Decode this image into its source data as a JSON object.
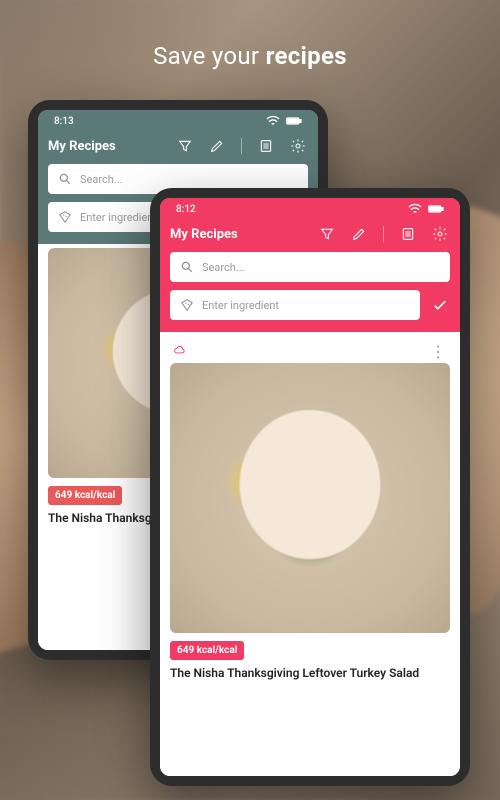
{
  "headline": {
    "prefix": "Save your ",
    "bold": "recipes"
  },
  "back": {
    "time": "8:13",
    "title": "My Recipes",
    "search_placeholder": "Search...",
    "ingredient_placeholder": "Enter ingredient",
    "card": {
      "kcal": "649 kcal/kcal",
      "title": "The Nisha Thanksgiv"
    }
  },
  "front": {
    "time": "8:12",
    "title": "My Recipes",
    "search_placeholder": "Search...",
    "ingredient_placeholder": "Enter ingredient",
    "card": {
      "kcal": "649 kcal/kcal",
      "title": "The Nisha Thanksgiving Leftover Turkey Salad"
    }
  }
}
